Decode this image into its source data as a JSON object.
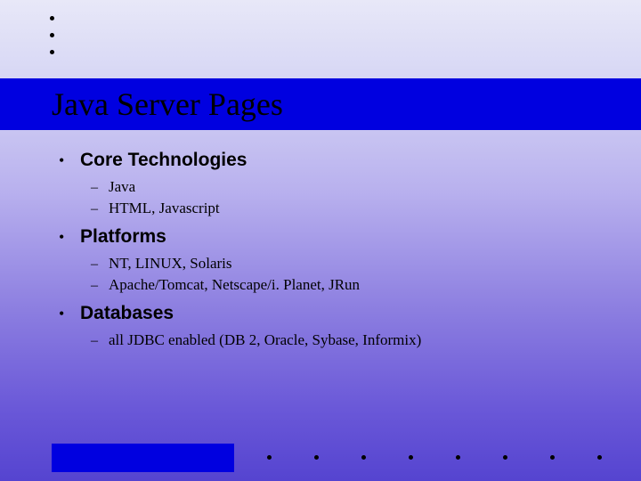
{
  "title": "Java Server Pages",
  "sections": [
    {
      "heading": "Core Technologies",
      "items": [
        "Java",
        "HTML, Javascript"
      ]
    },
    {
      "heading": "Platforms",
      "items": [
        "NT, LINUX, Solaris",
        "Apache/Tomcat, Netscape/i. Planet, JRun"
      ]
    },
    {
      "heading": "Databases",
      "items": [
        "all JDBC enabled (DB 2, Oracle, Sybase, Informix)"
      ]
    }
  ]
}
